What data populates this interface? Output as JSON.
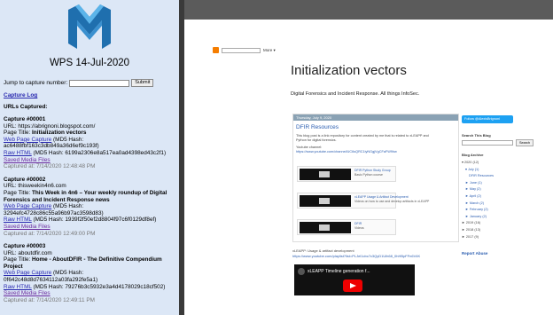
{
  "wps": {
    "title": "WPS 14-Jul-2020",
    "jump_label": "Jump to capture number:",
    "submit_label": "Submit",
    "capture_log_label": "Capture Log",
    "urls_heading": "URLs Captured:",
    "captures": [
      {
        "number": "Capture #00001",
        "url": "URL: https://abrignoni.blogspot.com/",
        "page_title_label": "Page Title: ",
        "page_title": "Initialization vectors",
        "web_capture_label": "Web Page Capture",
        "web_capture_hash": " (MD5 Hash: ac6488fbf163c3db849a36d6ef9c193f)",
        "raw_label": "Raw HTML",
        "raw_hash": " (MD5 Hash: 6199a2306e8a517ea0ad4398ed43c2f1)",
        "media_label": "Saved Media Files",
        "captured_at": "Captured at: 7/14/2020 12:48:48 PM"
      },
      {
        "number": "Capture #00002",
        "url": "URL: thisweekin4n6.com",
        "page_title_label": "Page Title: ",
        "page_title": "This Week in 4n6 – Your weekly roundup of Digital Forensics and Incident Response news",
        "web_capture_label": "Web Page Capture",
        "web_capture_hash": " (MD5 Hash: 3294efc4728c86c55a96b97ac3598d83)",
        "raw_label": "Raw HTML",
        "raw_hash": " (MD5 Hash: 1939f2f50ef2d8804f97c6f0129df8ef)",
        "media_label": "Saved Media Files",
        "captured_at": "Captured at: 7/14/2020 12:49:00 PM"
      },
      {
        "number": "Capture #00003",
        "url": "URL: aboutdfir.com",
        "page_title_label": "Page Title: ",
        "page_title": "Home - AboutDFIR - The Definitive Compendium Project",
        "web_capture_label": "Web Page Capture",
        "web_capture_hash": " (MD5 Hash: 0f642c48d8d7634112a03fa292fe5a1)",
        "raw_label": "Raw HTML",
        "raw_hash": " (MD5 Hash: 79276b3c5932e3a4d4178029c18cf502)",
        "media_label": "Saved Media Files",
        "captured_at": "Captured at: 7/14/2020 12:49:11 PM"
      }
    ]
  },
  "blog": {
    "nav_more": "More ▾",
    "title": "Initialization vectors",
    "description": "Digital Forensics and Incident Response. All things InfoSec.",
    "post": {
      "date": "Thursday, July 9, 2020",
      "title": "DFIR Resources",
      "intro_1": "This blog post is a link repository for content created by me that is related to xLEAPP and",
      "intro_2": "Python for digital forensics.",
      "channel_label": "Youtube channel:",
      "channel_url": "https://www.youtube.com/channel/UC6sQRC1iyNGgjVgCFaFW9hw",
      "cards": [
        {
          "title": "DFIR Python Study Group",
          "sub": "Basic Python course"
        },
        {
          "title": "xLEAPP Usage & Artifact Development",
          "sub": "Videos on how to use and develop artifacts in xLEAPP"
        },
        {
          "title": "DFIR",
          "sub": "Videos"
        }
      ]
    },
    "below_label": "xLEAPP: Usage & artifact development",
    "below_url": "https://www.youtube.com/playlist?list=PLJel1cbc7c3QyD1Ulh68_0hHBpFFn6V4K",
    "video_title": "xLEAPP Timeline generation f...",
    "sidebar": {
      "follow_label": "Follow @AlexisBrignoni",
      "search_label": "Search This Blog",
      "search_button": "Search",
      "archive_label": "Blog Archive",
      "archive": [
        {
          "label": "▾ 2020 (12)",
          "indent": 0
        },
        {
          "label": "▾ July (1)",
          "indent": 1
        },
        {
          "label": "DFIR Resources",
          "indent": 2
        },
        {
          "label": "► June (1)",
          "indent": 1
        },
        {
          "label": "► May (2)",
          "indent": 1
        },
        {
          "label": "► April (2)",
          "indent": 1
        },
        {
          "label": "► March (2)",
          "indent": 1
        },
        {
          "label": "► February (2)",
          "indent": 1
        },
        {
          "label": "► January (2)",
          "indent": 1
        },
        {
          "label": "► 2019 (16)",
          "indent": 0
        },
        {
          "label": "► 2018 (13)",
          "indent": 0
        },
        {
          "label": "► 2017 (9)",
          "indent": 0
        }
      ],
      "report_abuse": "Report Abuse"
    }
  },
  "colors": {
    "panel_bg": "#dce7f6",
    "logo_dark": "#1f6fae",
    "logo_light": "#5bb4ea",
    "link": "#2a2ab0",
    "visited": "#6a2a9e",
    "twitter": "#1da1f2",
    "youtube_red": "#ee0000"
  }
}
